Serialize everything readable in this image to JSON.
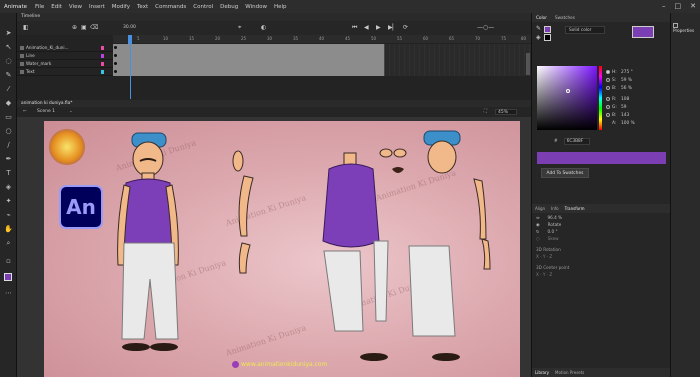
{
  "menu": {
    "app": "Animate",
    "items": [
      "File",
      "Edit",
      "View",
      "Insert",
      "Modify",
      "Text",
      "Commands",
      "Control",
      "Debug",
      "Window",
      "Help"
    ]
  },
  "timeline": {
    "title": "Timeline",
    "fps": "30.00",
    "frame_marks": [
      "5",
      "10",
      "15",
      "20",
      "25",
      "30",
      "35",
      "40",
      "45",
      "50",
      "55",
      "60",
      "65",
      "70",
      "75",
      "80",
      "85"
    ],
    "layers": [
      {
        "name": "Animation_Ki_duni...",
        "color": "#e84ea1"
      },
      {
        "name": "Line",
        "color": "#b544e0"
      },
      {
        "name": "Water_mark",
        "color": "#e84ea1"
      },
      {
        "name": "Text",
        "color": "#33c6e8"
      }
    ]
  },
  "document": {
    "tab": "animation ki duniya.fla*",
    "scene": "Scene 1",
    "zoom": "45%"
  },
  "stage": {
    "watermark": "Animation Ki Duniya",
    "banner": "www.animationkiduniya.com",
    "logo_text": "An"
  },
  "color_panel": {
    "tabs": [
      "Color",
      "Swatches"
    ],
    "fill_type": "Solid color",
    "fill_color": "#7B3FB3",
    "hsb": [
      {
        "k": "H:",
        "v": "275 °",
        "on": true
      },
      {
        "k": "S:",
        "v": "59 %",
        "on": false
      },
      {
        "k": "B:",
        "v": "56 %",
        "on": false
      },
      {
        "k": "R:",
        "v": "108",
        "on": false
      },
      {
        "k": "G:",
        "v": "59",
        "on": false
      },
      {
        "k": "B:",
        "v": "143",
        "on": false
      },
      {
        "k": "A:",
        "v": "100 %",
        "on": false
      }
    ],
    "hex": "6C3B8F",
    "add_button": "Add To Swatches"
  },
  "transform_panel": {
    "tabs": [
      "Align",
      "Info",
      "Transform"
    ],
    "scale": "96.4 %",
    "rotate_label": "Rotate",
    "rotate_value": "0.0 °",
    "skew_label": "Skew",
    "rotation3d": "3D Rotation",
    "center3d": "3D Center point"
  },
  "library": {
    "tabs": [
      "Library",
      "Motion Presets"
    ]
  },
  "properties": {
    "title": "Properties"
  }
}
